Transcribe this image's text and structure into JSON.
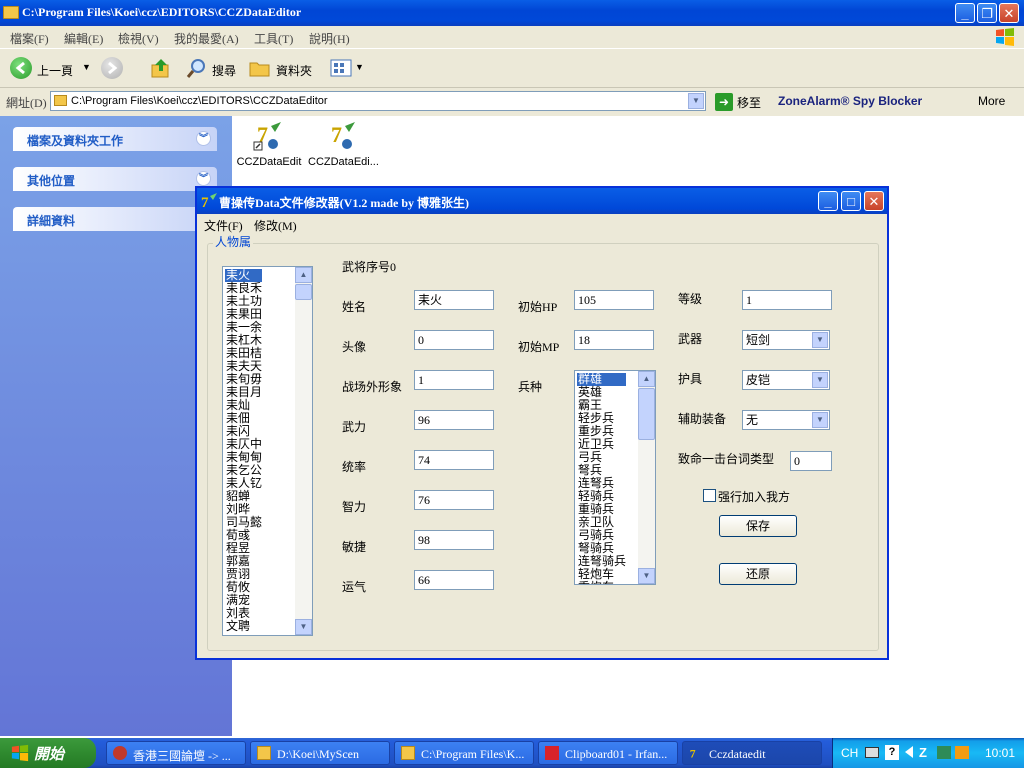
{
  "explorer": {
    "title": "C:\\Program Files\\Koei\\ccz\\EDITORS\\CCZDataEditor",
    "menu": [
      "檔案(F)",
      "編輯(E)",
      "檢視(V)",
      "我的最愛(A)",
      "工具(T)",
      "說明(H)"
    ],
    "toolbar": {
      "back": "上一頁",
      "search": "搜尋",
      "folders": "資料夾"
    },
    "address_label": "網址(D)",
    "address_value": "C:\\Program Files\\Koei\\ccz\\EDITORS\\CCZDataEditor",
    "go_label": "移至",
    "zonealarm": "ZoneAlarm® Spy Blocker",
    "more": "More"
  },
  "left_pane": {
    "boxes": [
      "檔案及資料夾工作",
      "其他位置",
      "詳細資料"
    ]
  },
  "files": [
    "CCZDataEdit",
    "CCZDataEdi..."
  ],
  "dialog": {
    "title": "曹操传Data文件修改器(V1.2 made by 博雅张生)",
    "menu": [
      "文件(F)",
      "修改(M)"
    ],
    "group_label": "人物属",
    "char_list": [
      "耒火",
      "耒良禾",
      "耒土功",
      "耒果田",
      "耒一余",
      "耒杠木",
      "耒田桔",
      "耒夫天",
      "耒旬毋",
      "耒目月",
      "耒灿",
      "耒佃",
      "耒闪",
      "耒仄中",
      "耒甸甸",
      "耒乞公",
      "耒人钇",
      "貂蝉",
      "刘晔",
      "司马懿",
      "荀彧",
      "程昱",
      "郭嘉",
      "贾诩",
      "荀攸",
      "满宠",
      "刘表",
      "文聘"
    ],
    "selected_char_index": 0,
    "general_no": "武将序号0",
    "fields": {
      "name_label": "姓名",
      "name_value": "耒火",
      "portrait_label": "头像",
      "portrait_value": "0",
      "battle_image_label": "战场外形象",
      "battle_image_value": "1",
      "force_label": "武力",
      "force_value": "96",
      "command_label": "统率",
      "command_value": "74",
      "intel_label": "智力",
      "intel_value": "76",
      "agility_label": "敏捷",
      "agility_value": "98",
      "luck_label": "运气",
      "luck_value": "66",
      "hp_label": "初始HP",
      "hp_value": "105",
      "mp_label": "初始MP",
      "mp_value": "18",
      "unit_label": "兵种",
      "level_label": "等级",
      "level_value": "1",
      "weapon_label": "武器",
      "weapon_value": "短剑",
      "armor_label": "护具",
      "armor_value": "皮铠",
      "accessory_label": "辅助装备",
      "accessory_value": "无",
      "critical_label": "致命一击台词类型",
      "critical_value": "0",
      "force_join_label": "强行加入我方"
    },
    "unit_list": [
      "群雄",
      "英雄",
      "霸王",
      "轻步兵",
      "重步兵",
      "近卫兵",
      "弓兵",
      "弩兵",
      "连弩兵",
      "轻骑兵",
      "重骑兵",
      "亲卫队",
      "弓骑兵",
      "弩骑兵",
      "连弩骑兵",
      "轻炮车",
      "重炮车"
    ],
    "selected_unit_index": 0,
    "save_button": "保存",
    "restore_button": "还原"
  },
  "taskbar": {
    "start": "開始",
    "tasks": [
      "香港三國論壇 -> ...",
      "D:\\Koei\\MyScen",
      "C:\\Program Files\\K...",
      "Clipboard01 - Irfan...",
      "Cczdataedit"
    ],
    "active_task_index": 4,
    "tray_lang": "CH",
    "clock": "10:01"
  }
}
